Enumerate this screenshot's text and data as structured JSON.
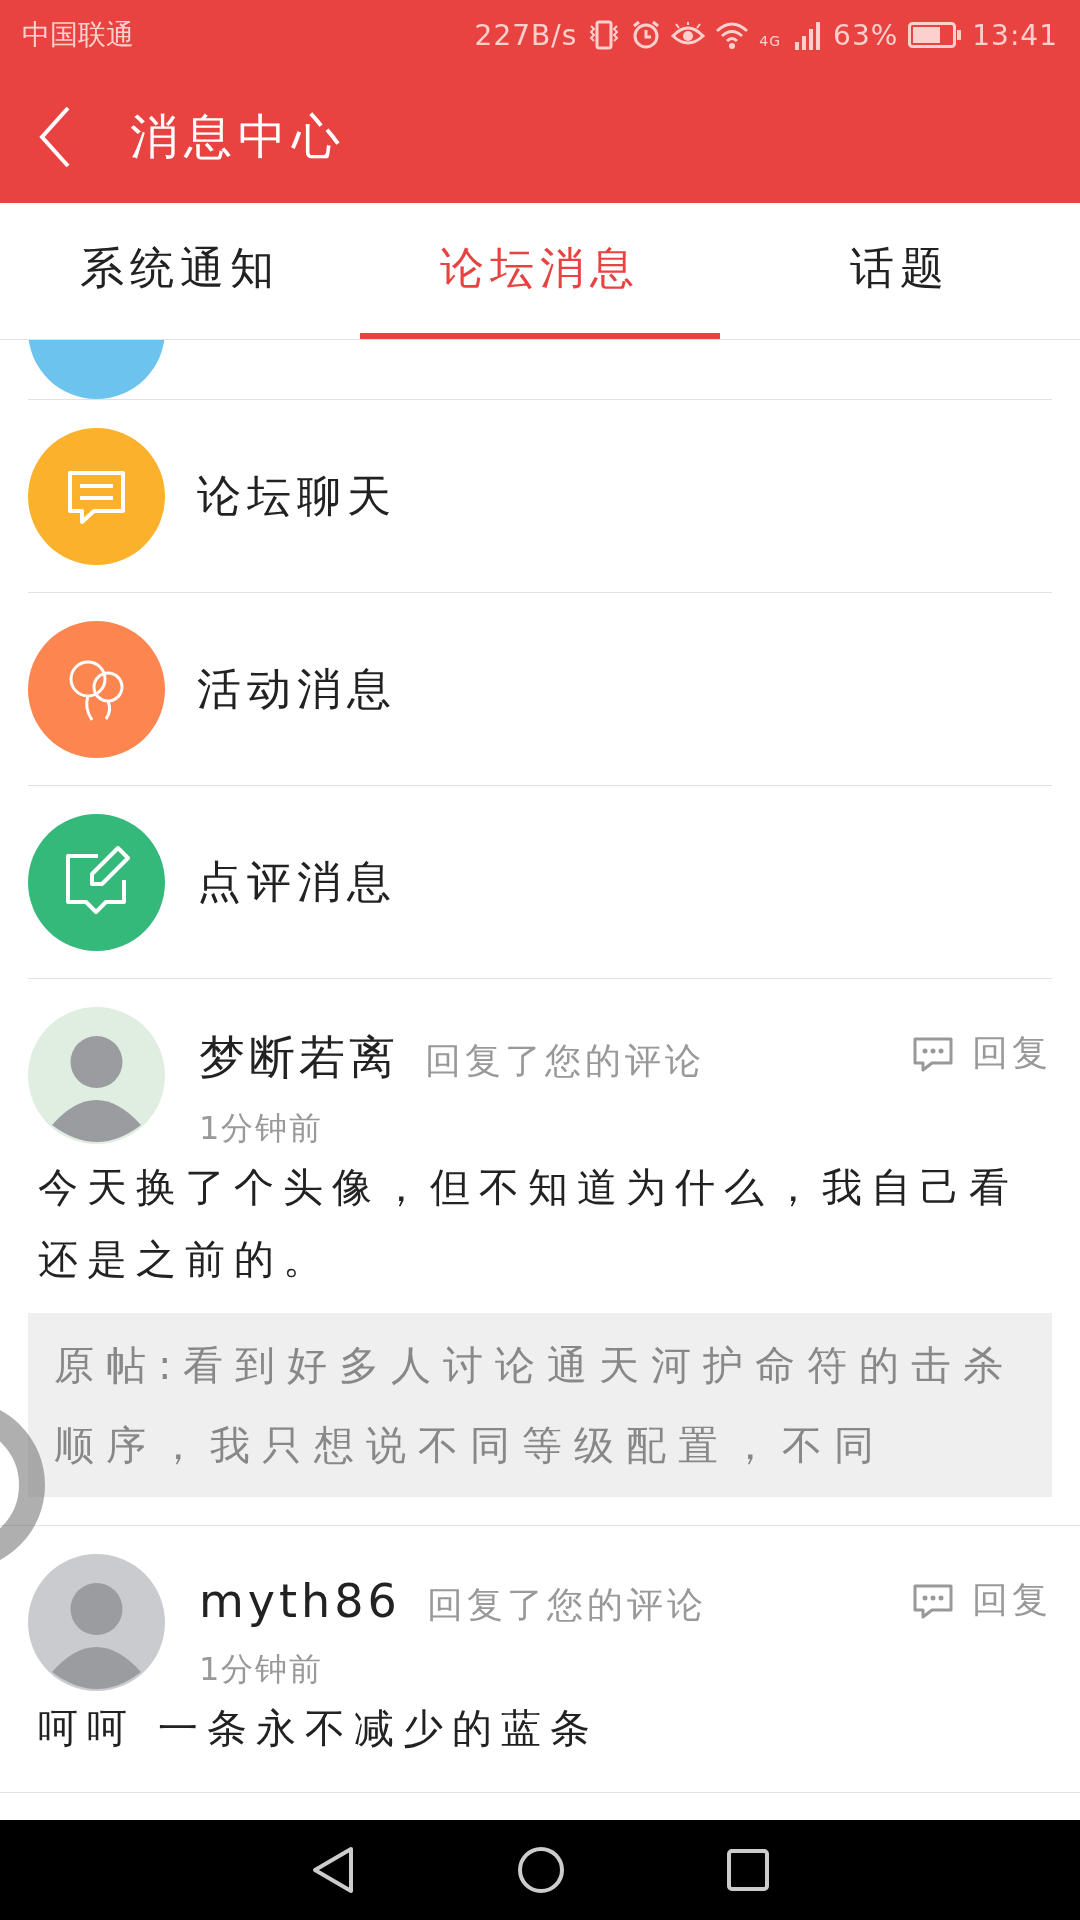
{
  "status_bar": {
    "carrier": "中国联通",
    "net_speed": "227B/s",
    "network_type": "4G",
    "battery": "63%",
    "time": "13:41"
  },
  "header": {
    "title": "消息中心"
  },
  "tabs": [
    {
      "label": "系统通知",
      "selected": false
    },
    {
      "label": "论坛消息",
      "selected": true
    },
    {
      "label": "话题",
      "selected": false
    }
  ],
  "categories": [
    {
      "kind": "notice"
    },
    {
      "kind": "chat",
      "label": "论坛聊天"
    },
    {
      "kind": "activity",
      "label": "活动消息"
    },
    {
      "kind": "review",
      "label": "点评消息"
    }
  ],
  "comments": [
    {
      "user": "梦断若离",
      "action": "回复了您的评论",
      "time": "1分钟前",
      "reply": "回复",
      "body": "今天换了个头像，但不知道为什么，我自己看还是之前的。",
      "quote": "原帖:看到好多人讨论通天河护命符的击杀顺序，我只想说不同等级配置，不同"
    },
    {
      "user": "myth86",
      "action": "回复了您的评论",
      "time": "1分钟前",
      "reply": "回复",
      "body": "呵呵 一条永不减少的蓝条"
    }
  ]
}
